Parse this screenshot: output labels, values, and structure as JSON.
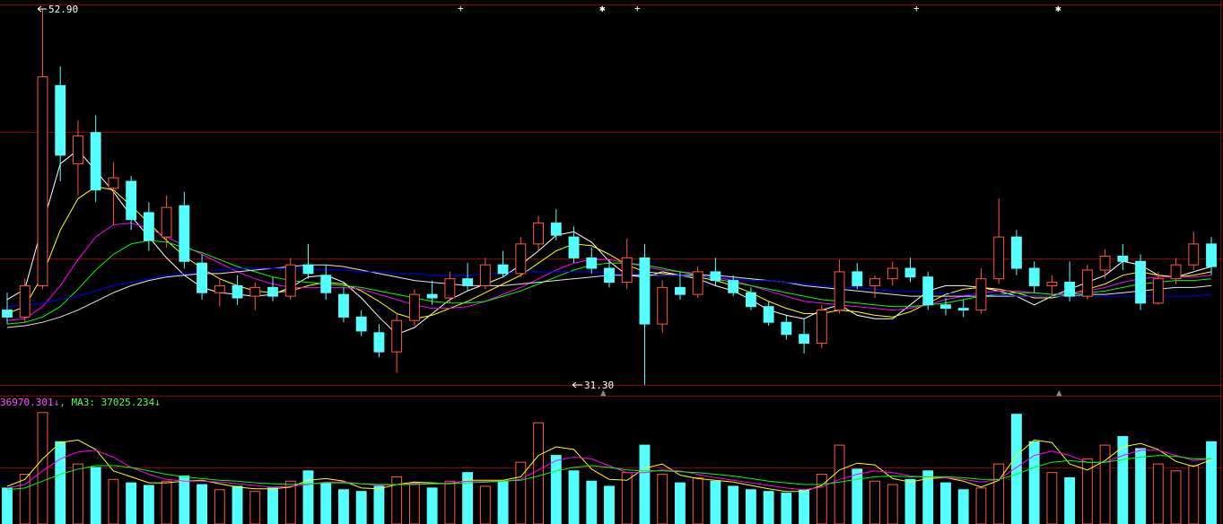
{
  "header": {
    "price_legend_text": "",
    "volume_legend": [
      {
        "text": "36970.301↓",
        "color": "#ff55ff"
      },
      {
        "text": ", MA3: 37025.234↓",
        "color": "#55ff55"
      }
    ]
  },
  "annotations": {
    "high_label": "52.90",
    "low_label": "31.30",
    "top_markers": [
      "+",
      "✱",
      "+",
      "+",
      "✱"
    ],
    "bottom_markers": [
      "▲",
      "▲"
    ]
  },
  "colors": {
    "up": "#ff5a3a",
    "down": "#54ffff",
    "grid": "#8a0000",
    "ma5": "#ffffff",
    "ma10": "#ffff00",
    "ma20": "#ff00ff",
    "ma30": "#00ff00",
    "ma60": "#e6e6e6",
    "ma120": "#0000ff",
    "vol_ma_a": "#ffff00",
    "vol_ma_b": "#ff00ff",
    "vol_ma_c": "#00ff00"
  },
  "chart_data": {
    "type": "candlestick",
    "price_range": [
      31.3,
      52.9
    ],
    "series": [
      {
        "name": "MA5",
        "values": [
          36.2,
          36.8,
          40.5,
          44.0,
          44.8,
          43.6,
          42.4,
          41.0,
          39.8,
          38.6,
          37.6,
          36.9,
          36.6,
          36.5,
          36.4,
          36.5,
          36.9,
          37.5,
          37.6,
          37.2,
          36.3,
          35.2,
          34.2,
          34.6,
          35.4,
          36.2,
          36.7,
          37.1,
          37.5,
          38.2,
          39.0,
          39.9,
          40.1,
          39.5,
          38.4,
          37.6,
          37.5,
          37.8,
          37.6,
          37.4,
          37.0,
          36.7,
          36.2,
          35.6,
          35.3,
          35.1,
          35.6,
          35.9,
          35.3,
          35.1,
          35.1,
          35.9,
          36.7,
          37.0,
          37.0,
          36.9,
          36.7,
          36.4,
          35.9,
          36.4,
          36.8,
          37.2,
          37.6,
          38.4,
          38.2,
          37.6,
          37.5,
          37.8,
          38.1
        ]
      },
      {
        "name": "MA10",
        "values": [
          35.4,
          35.8,
          37.6,
          40.2,
          42.0,
          42.7,
          42.5,
          41.6,
          40.6,
          39.6,
          38.7,
          38.0,
          37.4,
          37.0,
          36.7,
          36.6,
          36.7,
          37.0,
          37.2,
          37.1,
          36.7,
          36.1,
          35.4,
          35.1,
          35.3,
          35.7,
          36.1,
          36.6,
          37.1,
          37.6,
          38.3,
          39.0,
          39.4,
          39.3,
          38.8,
          38.2,
          37.8,
          37.7,
          37.6,
          37.5,
          37.3,
          37.0,
          36.6,
          36.1,
          35.7,
          35.4,
          35.4,
          35.6,
          35.5,
          35.3,
          35.2,
          35.5,
          36.0,
          36.5,
          36.8,
          36.9,
          36.8,
          36.6,
          36.3,
          36.3,
          36.5,
          36.8,
          37.1,
          37.6,
          37.8,
          37.6,
          37.5,
          37.6,
          37.8
        ]
      },
      {
        "name": "MA20",
        "values": [
          35.0,
          35.1,
          35.8,
          37.0,
          38.5,
          39.8,
          40.5,
          40.6,
          40.3,
          39.8,
          39.3,
          38.8,
          38.3,
          37.8,
          37.4,
          37.1,
          36.9,
          36.9,
          36.9,
          36.9,
          36.8,
          36.5,
          36.2,
          35.9,
          35.7,
          35.7,
          35.8,
          36.1,
          36.5,
          36.9,
          37.4,
          37.9,
          38.3,
          38.5,
          38.5,
          38.3,
          38.1,
          37.9,
          37.8,
          37.7,
          37.5,
          37.3,
          37.0,
          36.7,
          36.4,
          36.1,
          36.0,
          35.9,
          35.8,
          35.7,
          35.6,
          35.7,
          35.9,
          36.2,
          36.4,
          36.6,
          36.7,
          36.7,
          36.6,
          36.5,
          36.6,
          36.7,
          36.9,
          37.2,
          37.4,
          37.5,
          37.5,
          37.5,
          37.6
        ]
      },
      {
        "name": "MA30",
        "values": [
          34.8,
          34.9,
          35.2,
          35.8,
          36.8,
          37.9,
          38.8,
          39.4,
          39.6,
          39.5,
          39.2,
          38.9,
          38.5,
          38.1,
          37.8,
          37.5,
          37.3,
          37.2,
          37.1,
          37.0,
          36.9,
          36.7,
          36.5,
          36.3,
          36.1,
          36.0,
          36.0,
          36.1,
          36.4,
          36.7,
          37.1,
          37.5,
          37.9,
          38.2,
          38.3,
          38.3,
          38.2,
          38.0,
          37.8,
          37.6,
          37.4,
          37.2,
          37.0,
          36.8,
          36.6,
          36.4,
          36.2,
          36.1,
          36.0,
          35.9,
          35.8,
          35.8,
          35.9,
          36.0,
          36.2,
          36.4,
          36.5,
          36.6,
          36.6,
          36.5,
          36.5,
          36.6,
          36.7,
          36.9,
          37.1,
          37.2,
          37.3,
          37.3,
          37.4
        ]
      },
      {
        "name": "MA60",
        "values": [
          34.6,
          34.7,
          34.9,
          35.2,
          35.6,
          36.1,
          36.6,
          37.0,
          37.3,
          37.5,
          37.6,
          37.7,
          37.7,
          37.8,
          37.9,
          38.0,
          38.1,
          38.2,
          38.2,
          38.1,
          37.9,
          37.7,
          37.5,
          37.3,
          37.2,
          37.1,
          37.0,
          37.0,
          37.0,
          37.1,
          37.2,
          37.3,
          37.4,
          37.5,
          37.6,
          37.6,
          37.6,
          37.6,
          37.6,
          37.6,
          37.6,
          37.5,
          37.4,
          37.3,
          37.2,
          37.0,
          36.9,
          36.8,
          36.7,
          36.6,
          36.5,
          36.4,
          36.4,
          36.4,
          36.4,
          36.4,
          36.4,
          36.4,
          36.4,
          36.4,
          36.4,
          36.5,
          36.5,
          36.6,
          36.7,
          36.8,
          36.9,
          36.9,
          37.0
        ]
      },
      {
        "name": "MA120",
        "values": [
          35.8,
          35.9,
          36.0,
          36.2,
          36.4,
          36.7,
          37.0,
          37.2,
          37.4,
          37.6,
          37.7,
          37.8,
          37.9,
          38.0,
          38.0,
          38.0,
          38.0,
          38.0,
          37.9,
          37.9,
          37.8,
          37.8,
          37.7,
          37.7,
          37.6,
          37.6,
          37.6,
          37.7,
          37.7,
          37.8,
          37.8,
          37.8,
          37.8,
          37.8,
          37.7,
          37.7,
          37.7,
          37.6,
          37.6,
          37.5,
          37.5,
          37.4,
          37.3,
          37.3,
          37.2,
          37.1,
          37.0,
          36.9,
          36.9,
          36.8,
          36.7,
          36.7,
          36.6,
          36.6,
          36.5,
          36.5,
          36.5,
          36.4,
          36.4,
          36.4,
          36.4,
          36.4,
          36.4,
          36.4,
          36.4,
          36.4,
          36.4,
          36.4,
          36.5
        ]
      }
    ],
    "candles": [
      {
        "o": 35.6,
        "h": 36.6,
        "l": 34.8,
        "c": 35.2
      },
      {
        "o": 35.2,
        "h": 37.4,
        "l": 34.9,
        "c": 37.0
      },
      {
        "o": 37.0,
        "h": 52.9,
        "l": 36.8,
        "c": 49.0
      },
      {
        "o": 48.5,
        "h": 49.6,
        "l": 43.0,
        "c": 44.5
      },
      {
        "o": 44.0,
        "h": 46.5,
        "l": 42.2,
        "c": 45.6
      },
      {
        "o": 45.8,
        "h": 46.8,
        "l": 41.8,
        "c": 42.5
      },
      {
        "o": 42.6,
        "h": 44.1,
        "l": 40.5,
        "c": 43.2
      },
      {
        "o": 43.0,
        "h": 43.3,
        "l": 40.2,
        "c": 40.8
      },
      {
        "o": 41.2,
        "h": 41.8,
        "l": 39.0,
        "c": 39.6
      },
      {
        "o": 39.8,
        "h": 42.2,
        "l": 39.2,
        "c": 41.5
      },
      {
        "o": 41.6,
        "h": 42.4,
        "l": 38.0,
        "c": 38.4
      },
      {
        "o": 38.3,
        "h": 38.8,
        "l": 36.2,
        "c": 36.6
      },
      {
        "o": 36.6,
        "h": 37.4,
        "l": 35.8,
        "c": 37.0
      },
      {
        "o": 37.0,
        "h": 37.6,
        "l": 35.9,
        "c": 36.3
      },
      {
        "o": 36.4,
        "h": 37.2,
        "l": 35.6,
        "c": 36.9
      },
      {
        "o": 36.9,
        "h": 37.5,
        "l": 36.1,
        "c": 36.4
      },
      {
        "o": 36.4,
        "h": 38.6,
        "l": 36.2,
        "c": 38.2
      },
      {
        "o": 38.2,
        "h": 39.4,
        "l": 37.4,
        "c": 37.7
      },
      {
        "o": 37.6,
        "h": 38.2,
        "l": 36.2,
        "c": 36.6
      },
      {
        "o": 36.5,
        "h": 36.9,
        "l": 34.9,
        "c": 35.2
      },
      {
        "o": 35.2,
        "h": 35.6,
        "l": 34.1,
        "c": 34.4
      },
      {
        "o": 34.3,
        "h": 34.8,
        "l": 32.9,
        "c": 33.2
      },
      {
        "o": 33.2,
        "h": 35.4,
        "l": 32.0,
        "c": 35.0
      },
      {
        "o": 35.0,
        "h": 36.8,
        "l": 34.7,
        "c": 36.5
      },
      {
        "o": 36.5,
        "h": 37.3,
        "l": 35.9,
        "c": 36.3
      },
      {
        "o": 36.3,
        "h": 37.8,
        "l": 36.0,
        "c": 37.4
      },
      {
        "o": 37.4,
        "h": 38.3,
        "l": 36.7,
        "c": 37.0
      },
      {
        "o": 37.0,
        "h": 38.6,
        "l": 36.8,
        "c": 38.2
      },
      {
        "o": 38.2,
        "h": 39.0,
        "l": 37.5,
        "c": 37.7
      },
      {
        "o": 37.7,
        "h": 39.8,
        "l": 37.5,
        "c": 39.4
      },
      {
        "o": 39.4,
        "h": 41.0,
        "l": 39.0,
        "c": 40.6
      },
      {
        "o": 40.6,
        "h": 41.4,
        "l": 39.6,
        "c": 39.9
      },
      {
        "o": 39.8,
        "h": 40.4,
        "l": 38.3,
        "c": 38.6
      },
      {
        "o": 38.6,
        "h": 39.2,
        "l": 37.7,
        "c": 38.0
      },
      {
        "o": 38.0,
        "h": 38.5,
        "l": 36.9,
        "c": 37.2
      },
      {
        "o": 37.2,
        "h": 39.7,
        "l": 36.8,
        "c": 38.6
      },
      {
        "o": 38.6,
        "h": 39.4,
        "l": 31.3,
        "c": 34.8
      },
      {
        "o": 34.8,
        "h": 37.3,
        "l": 34.3,
        "c": 36.9
      },
      {
        "o": 36.9,
        "h": 37.8,
        "l": 36.2,
        "c": 36.5
      },
      {
        "o": 36.5,
        "h": 38.1,
        "l": 36.3,
        "c": 37.8
      },
      {
        "o": 37.8,
        "h": 38.6,
        "l": 37.0,
        "c": 37.3
      },
      {
        "o": 37.3,
        "h": 37.6,
        "l": 36.4,
        "c": 36.6
      },
      {
        "o": 36.6,
        "h": 36.9,
        "l": 35.6,
        "c": 35.8
      },
      {
        "o": 35.8,
        "h": 36.1,
        "l": 34.7,
        "c": 34.9
      },
      {
        "o": 34.9,
        "h": 35.3,
        "l": 33.9,
        "c": 34.2
      },
      {
        "o": 34.2,
        "h": 35.1,
        "l": 33.1,
        "c": 33.7
      },
      {
        "o": 33.7,
        "h": 35.9,
        "l": 33.4,
        "c": 35.6
      },
      {
        "o": 35.6,
        "h": 38.5,
        "l": 35.4,
        "c": 37.8
      },
      {
        "o": 37.8,
        "h": 38.3,
        "l": 36.8,
        "c": 37.0
      },
      {
        "o": 37.0,
        "h": 37.6,
        "l": 36.3,
        "c": 37.4
      },
      {
        "o": 37.4,
        "h": 38.4,
        "l": 37.0,
        "c": 38.0
      },
      {
        "o": 38.0,
        "h": 38.6,
        "l": 37.2,
        "c": 37.5
      },
      {
        "o": 37.5,
        "h": 37.8,
        "l": 35.6,
        "c": 35.9
      },
      {
        "o": 35.9,
        "h": 36.3,
        "l": 35.3,
        "c": 35.7
      },
      {
        "o": 35.7,
        "h": 36.2,
        "l": 35.2,
        "c": 35.6
      },
      {
        "o": 35.6,
        "h": 38.0,
        "l": 35.4,
        "c": 37.4
      },
      {
        "o": 37.4,
        "h": 42.0,
        "l": 37.1,
        "c": 39.8
      },
      {
        "o": 39.8,
        "h": 40.2,
        "l": 37.6,
        "c": 38.0
      },
      {
        "o": 38.0,
        "h": 38.4,
        "l": 36.6,
        "c": 37.0
      },
      {
        "o": 37.0,
        "h": 37.6,
        "l": 36.4,
        "c": 37.2
      },
      {
        "o": 37.2,
        "h": 38.4,
        "l": 36.1,
        "c": 36.4
      },
      {
        "o": 36.4,
        "h": 38.2,
        "l": 36.2,
        "c": 37.9
      },
      {
        "o": 37.9,
        "h": 39.1,
        "l": 37.4,
        "c": 38.7
      },
      {
        "o": 38.7,
        "h": 39.4,
        "l": 37.9,
        "c": 38.4
      },
      {
        "o": 38.4,
        "h": 38.8,
        "l": 35.6,
        "c": 36.0
      },
      {
        "o": 36.0,
        "h": 37.8,
        "l": 35.9,
        "c": 37.4
      },
      {
        "o": 37.4,
        "h": 38.6,
        "l": 37.1,
        "c": 38.2
      },
      {
        "o": 38.2,
        "h": 40.1,
        "l": 37.9,
        "c": 39.4
      },
      {
        "o": 39.4,
        "h": 39.8,
        "l": 37.6,
        "c": 38.1
      }
    ],
    "volume": [
      42,
      58,
      130,
      96,
      70,
      66,
      52,
      48,
      45,
      50,
      56,
      46,
      40,
      44,
      38,
      42,
      50,
      62,
      48,
      40,
      38,
      44,
      55,
      48,
      42,
      50,
      60,
      44,
      50,
      72,
      118,
      80,
      62,
      50,
      44,
      60,
      92,
      58,
      48,
      54,
      50,
      44,
      40,
      38,
      36,
      40,
      58,
      92,
      64,
      50,
      46,
      52,
      62,
      48,
      40,
      42,
      70,
      128,
      96,
      60,
      54,
      76,
      92,
      102,
      88,
      70,
      62,
      68,
      96
    ],
    "volume_ma": [
      {
        "name": "MA-A",
        "values": [
          44,
          52,
          76,
          95,
          98,
          87,
          62,
          55,
          48,
          48,
          50,
          51,
          47,
          43,
          41,
          41,
          43,
          51,
          53,
          50,
          42,
          41,
          46,
          49,
          48,
          47,
          51,
          51,
          51,
          55,
          80,
          90,
          87,
          64,
          52,
          51,
          65,
          70,
          57,
          53,
          51,
          49,
          45,
          41,
          38,
          38,
          45,
          63,
          71,
          69,
          53,
          49,
          53,
          54,
          50,
          43,
          51,
          80,
          98,
          95,
          70,
          63,
          74,
          90,
          94,
          87,
          73,
          67,
          75
        ]
      },
      {
        "name": "MA-B",
        "values": [
          42,
          46,
          62,
          76,
          84,
          86,
          78,
          66,
          58,
          52,
          50,
          50,
          49,
          47,
          45,
          43,
          44,
          46,
          49,
          49,
          47,
          45,
          46,
          47,
          47,
          48,
          50,
          50,
          50,
          52,
          63,
          74,
          78,
          76,
          68,
          60,
          60,
          63,
          62,
          58,
          54,
          51,
          48,
          45,
          42,
          40,
          43,
          52,
          58,
          62,
          60,
          56,
          55,
          54,
          52,
          49,
          52,
          66,
          80,
          85,
          80,
          72,
          72,
          80,
          86,
          86,
          80,
          74,
          76
        ]
      },
      {
        "name": "MA-C",
        "values": [
          40,
          42,
          50,
          58,
          64,
          68,
          68,
          66,
          62,
          58,
          55,
          53,
          51,
          50,
          48,
          47,
          46,
          47,
          48,
          48,
          47,
          46,
          46,
          46,
          47,
          47,
          48,
          49,
          50,
          51,
          56,
          62,
          66,
          68,
          66,
          63,
          62,
          62,
          61,
          60,
          58,
          56,
          53,
          50,
          48,
          46,
          46,
          49,
          52,
          55,
          56,
          55,
          55,
          55,
          54,
          52,
          52,
          58,
          66,
          72,
          74,
          72,
          72,
          75,
          78,
          80,
          79,
          76,
          76
        ]
      }
    ]
  }
}
